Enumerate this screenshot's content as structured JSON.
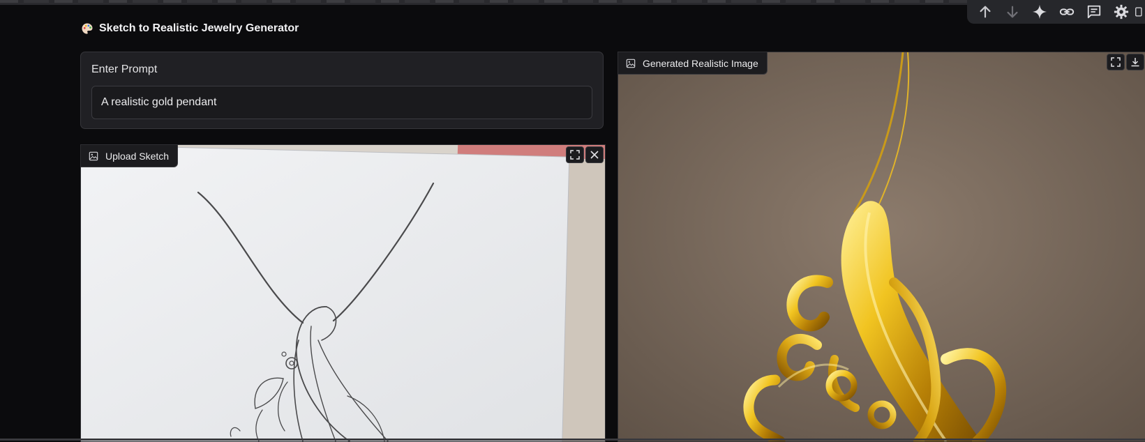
{
  "app": {
    "title": "Sketch to Realistic Jewelry Generator",
    "title_icon": "palette-icon"
  },
  "prompt": {
    "label": "Enter Prompt",
    "value": "A realistic gold pendant"
  },
  "sketch_panel": {
    "label": "Upload Sketch",
    "icon": "image-icon",
    "tools": [
      "fullscreen-icon",
      "close-icon"
    ]
  },
  "generated_panel": {
    "label": "Generated Realistic Image",
    "icon": "image-icon",
    "tools": [
      "fullscreen-icon",
      "download-icon"
    ]
  },
  "floating_toolbar": {
    "icons": [
      "arrow-up-icon",
      "arrow-down-icon",
      "sparkle-icon",
      "link-icon",
      "comment-icon",
      "gear-icon",
      "doc-icon"
    ]
  },
  "colors": {
    "background": "#0b0b0d",
    "card": "#202024",
    "gold": "#d9a514",
    "paper": "#eceef0"
  }
}
